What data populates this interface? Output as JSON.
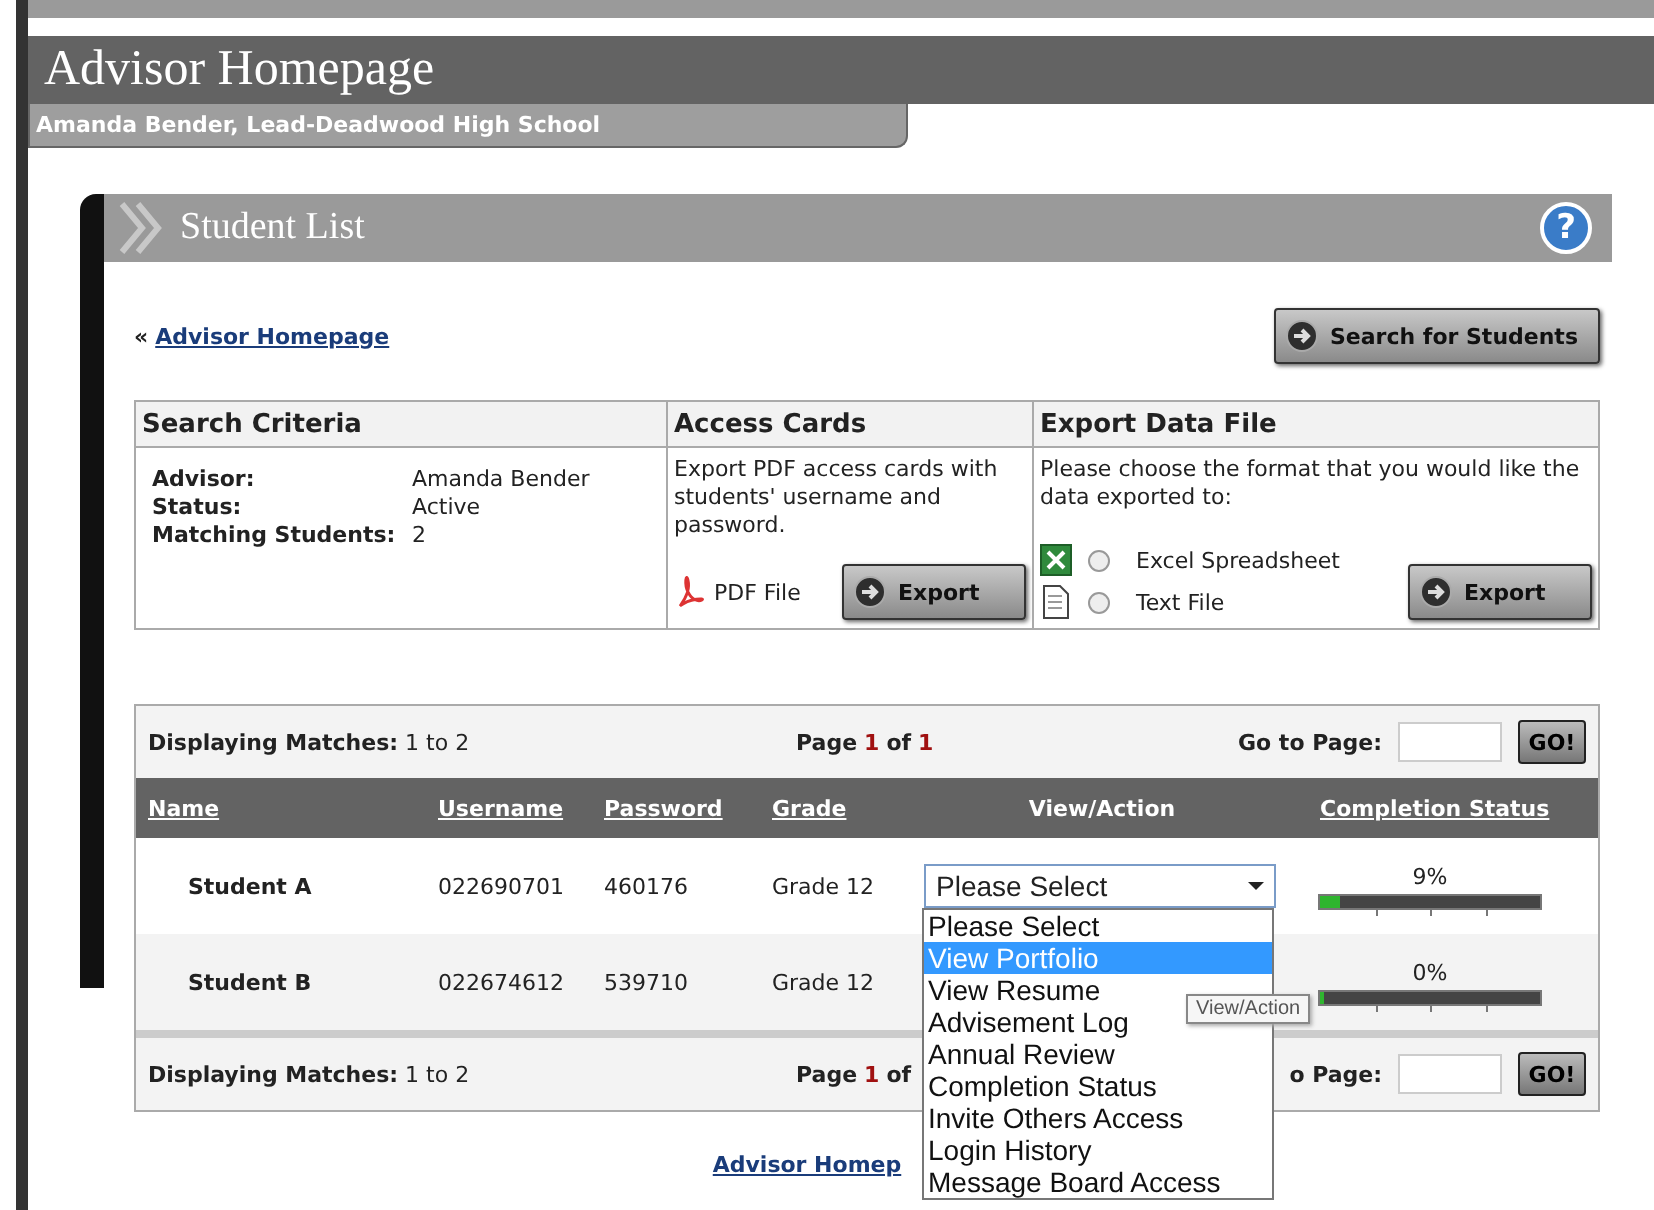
{
  "header": {
    "title": "Advisor Homepage",
    "subtitle": "Amanda Bender, Lead-Deadwood High School"
  },
  "panel": {
    "title": "Student List",
    "help": "?"
  },
  "back_link": {
    "prefix": "«",
    "label": "Advisor Homepage"
  },
  "search_button": "Search for Students",
  "search_criteria": {
    "heading": "Search Criteria",
    "fields": [
      {
        "label": "Advisor:",
        "value": "Amanda Bender"
      },
      {
        "label": "Status:",
        "value": "Active"
      },
      {
        "label": "Matching Students:",
        "value": "2"
      }
    ]
  },
  "access_cards": {
    "heading": "Access Cards",
    "text": "Export PDF access cards with students' username and password.",
    "file_label": "PDF File",
    "button": "Export"
  },
  "export_data": {
    "heading": "Export Data File",
    "text": "Please choose the format that you would like the data exported to:",
    "formats": [
      {
        "label": "Excel Spreadsheet",
        "kind": "excel",
        "selected": false
      },
      {
        "label": "Text File",
        "kind": "text",
        "selected": false
      }
    ],
    "button": "Export"
  },
  "results": {
    "top_bar": {
      "displaying_label": "Displaying Matches:",
      "displaying_value": "1 to 2",
      "page_label": "Page",
      "page_current": "1",
      "page_of": "of",
      "page_total": "1",
      "goto_label": "Go to Page:",
      "go_button": "GO!"
    },
    "columns": [
      {
        "label": "Name",
        "link": true
      },
      {
        "label": "Username",
        "link": true
      },
      {
        "label": "Password",
        "link": true
      },
      {
        "label": "Grade",
        "link": true
      },
      {
        "label": "View/Action",
        "link": false
      },
      {
        "label": "Completion Status",
        "link": true
      }
    ],
    "rows": [
      {
        "name": "Student A",
        "username": "022690701",
        "password": "460176",
        "grade": "Grade 12",
        "action": "Please Select",
        "completion": "9%",
        "level": 0.09
      },
      {
        "name": "Student B",
        "username": "022674612",
        "password": "539710",
        "grade": "Grade 12",
        "completion": "0%",
        "level": 0.0
      }
    ],
    "bottom_bar": {
      "displaying_label": "Displaying Matches:",
      "displaying_value": "1 to 2",
      "page_label": "Page",
      "page_current": "1",
      "page_of": "of",
      "goto_label": "o Page:",
      "go_button": "GO!"
    }
  },
  "dropdown": {
    "options": [
      {
        "label": "Please Select",
        "selected": false
      },
      {
        "label": "View Portfolio",
        "selected": true
      },
      {
        "label": "View Resume",
        "selected": false
      },
      {
        "label": "Advisement Log",
        "selected": false
      },
      {
        "label": "Annual Review",
        "selected": false
      },
      {
        "label": "Completion Status",
        "selected": false
      },
      {
        "label": "Invite Others Access",
        "selected": false
      },
      {
        "label": "Login History",
        "selected": false
      },
      {
        "label": "Message Board Access",
        "selected": false
      }
    ]
  },
  "tooltip": "View/Action",
  "footer_link": "Advisor Homep"
}
